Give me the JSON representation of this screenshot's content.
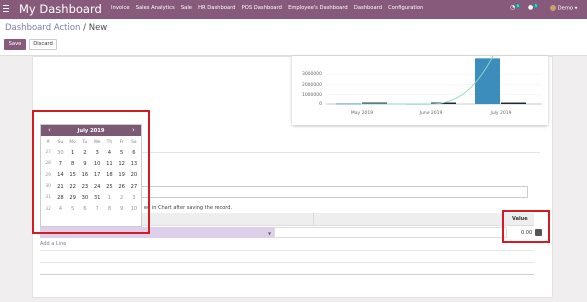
{
  "nav": {
    "brand": "My Dashboard",
    "menu": [
      "Invoice",
      "Sales Analytics",
      "Sale",
      "HR Dashboard",
      "POS Dashboard",
      "Employee's Dashboard",
      "Dashboard",
      "Configuration"
    ],
    "activity_count": "5",
    "message_count": "5",
    "user": "Demo"
  },
  "breadcrumb": {
    "parent": "Dashboard Action",
    "separator": " / ",
    "current": "New"
  },
  "toolbar": {
    "save_label": "Save",
    "discard_label": "Discard"
  },
  "chart": {
    "y_ticks": [
      "3000000",
      "2000000",
      "1000000",
      "0"
    ],
    "x_labels": [
      "May 2019",
      "June 2019",
      "July 2019"
    ]
  },
  "chart_data": {
    "type": "bar",
    "categories": [
      "May 2019",
      "June 2019",
      "July 2019"
    ],
    "series": [
      {
        "color": "#3c8dbc",
        "values": [
          50000,
          20000,
          4700000
        ]
      },
      {
        "color": "#20273a",
        "values": [
          150000,
          150000,
          150000
        ]
      }
    ],
    "line": {
      "color": "#8bdcc0",
      "values": [
        0,
        0,
        5800000
      ]
    },
    "ylim": [
      0,
      3500000
    ]
  },
  "datepicker": {
    "title": "July 2019",
    "weekdays": [
      "#",
      "Su",
      "Mo",
      "Tu",
      "We",
      "Th",
      "Fr",
      "Sa"
    ],
    "weeks": [
      [
        "27",
        "30",
        "1",
        "2",
        "3",
        "4",
        "5",
        "6"
      ],
      [
        "28",
        "7",
        "8",
        "9",
        "10",
        "11",
        "12",
        "13"
      ],
      [
        "29",
        "14",
        "15",
        "16",
        "17",
        "18",
        "19",
        "20"
      ],
      [
        "30",
        "21",
        "22",
        "23",
        "24",
        "25",
        "26",
        "27"
      ],
      [
        "31",
        "28",
        "29",
        "30",
        "31",
        "1",
        "2",
        "3"
      ],
      [
        "32",
        "4",
        "5",
        "6",
        "7",
        "8",
        "9",
        "10"
      ]
    ]
  },
  "form": {
    "note": "ed in Chart after saving the record.",
    "value_header": "Value",
    "value": "0.00",
    "add_line": "Add a Line"
  },
  "colors": {
    "brand": "#875a7b",
    "annotation": "#d41b23"
  }
}
